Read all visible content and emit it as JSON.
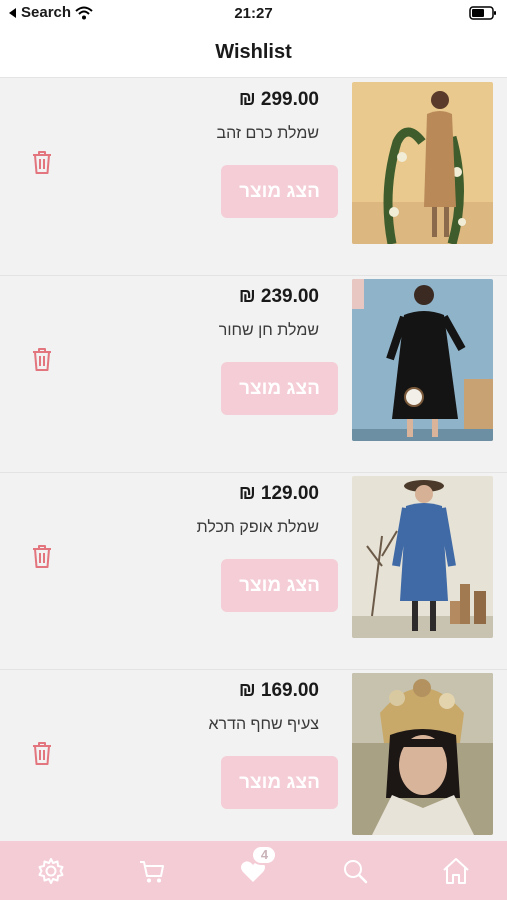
{
  "status_bar": {
    "back_label": "Search",
    "time": "21:27"
  },
  "header": {
    "title": "Wishlist"
  },
  "items": [
    {
      "price": "₪ 299.00",
      "name": "שמלת כרם זהב",
      "button_label": "הצג מוצר"
    },
    {
      "price": "₪ 239.00",
      "name": "שמלת חן שחור",
      "button_label": "הצג מוצר"
    },
    {
      "price": "₪ 129.00",
      "name": "שמלת אופק תכלת",
      "button_label": "הצג מוצר"
    },
    {
      "price": "₪ 169.00",
      "name": "צעיף שחף הדרא",
      "button_label": "הצג מוצר"
    }
  ],
  "tab_bar": {
    "wishlist_count": "4"
  },
  "colors": {
    "accent": "#f4ccd6",
    "trash": "#e2757d"
  },
  "icons": [
    "settings-icon",
    "cart-icon",
    "heart-icon",
    "search-icon",
    "home-icon",
    "trash-icon"
  ]
}
